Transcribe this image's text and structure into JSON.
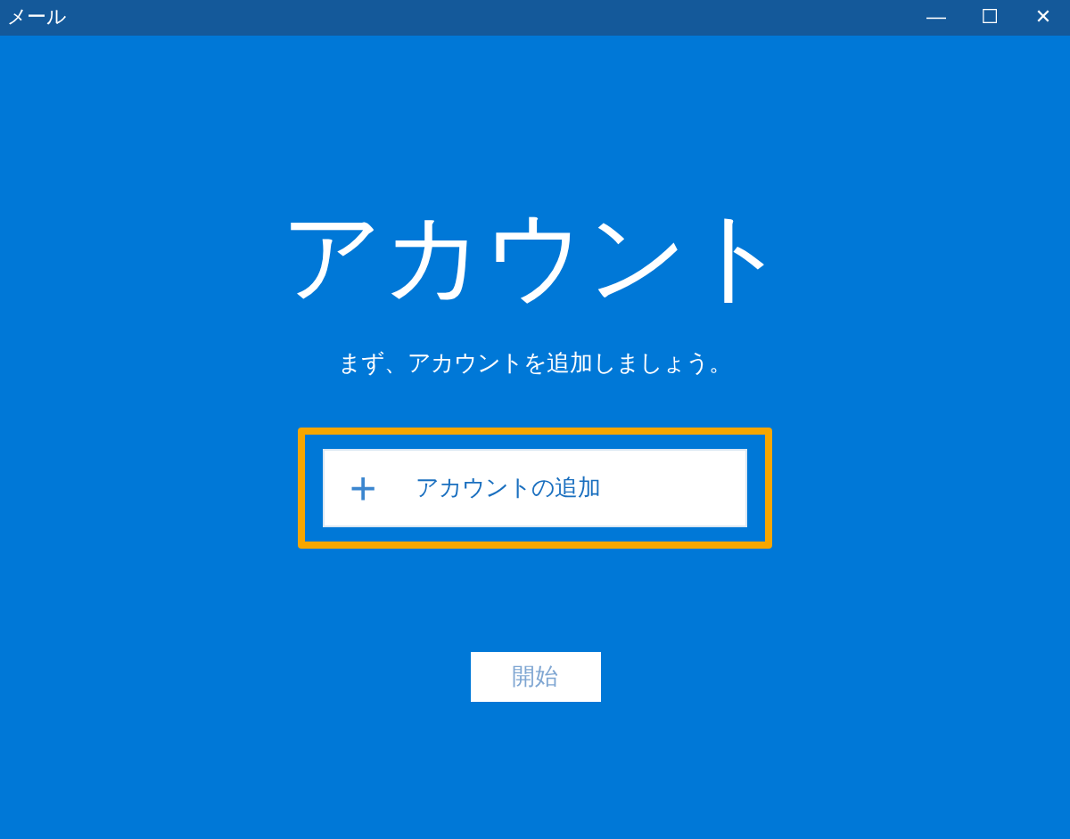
{
  "window": {
    "title": "メール",
    "controls": [
      "—",
      "☐",
      "✕"
    ]
  },
  "heading": "アカウント",
  "subtitle": "まず、アカウントを追加しましょう。",
  "add_account": {
    "icon": "+",
    "label": "アカウントの追加",
    "highlighted": true
  },
  "start_button": {
    "label": "開始",
    "disabled": true
  }
}
